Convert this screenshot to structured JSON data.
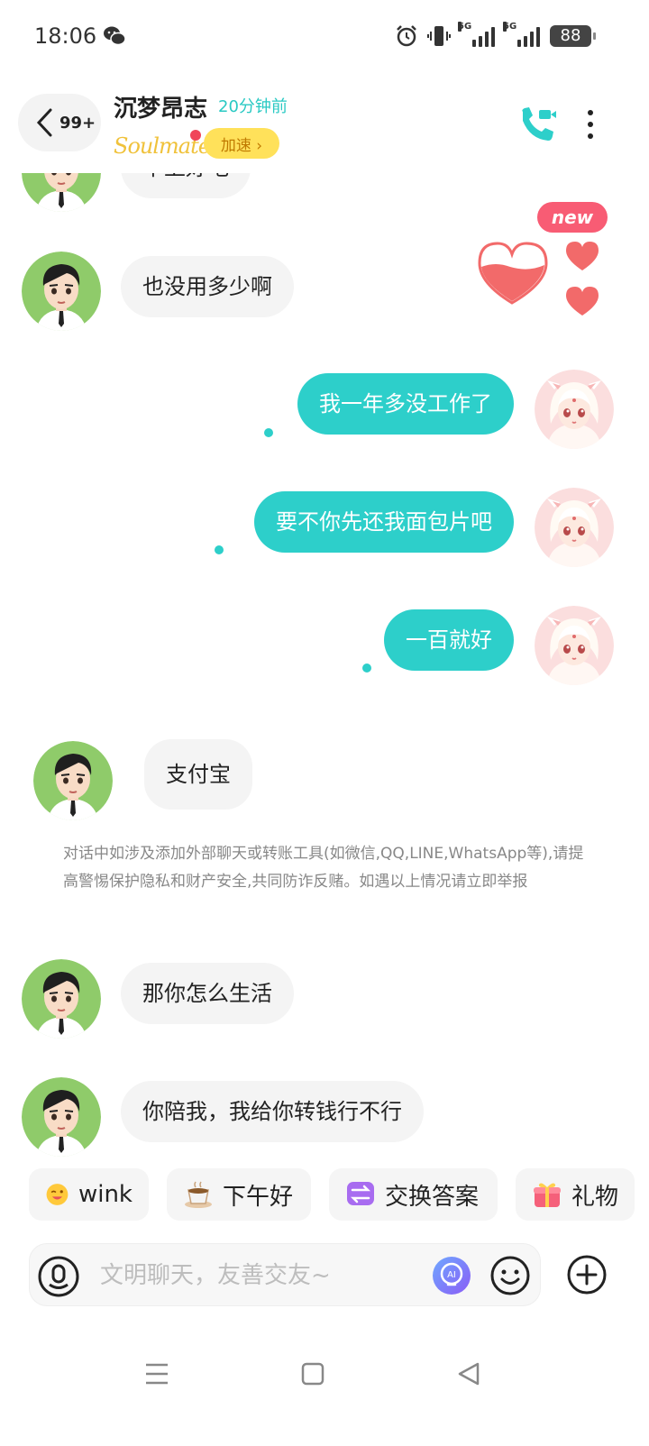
{
  "status_bar": {
    "time": "18:06",
    "battery": "88",
    "network_label_1": "5G",
    "network_label_2": "5G",
    "icons": [
      "wechat-icon",
      "alarm-icon",
      "vibrate-icon",
      "signal-icon",
      "signal-icon",
      "battery-icon"
    ]
  },
  "header": {
    "back_count": "99+",
    "contact_name": "沉梦昂志",
    "last_seen": "20分钟前",
    "brand": "Soulmate",
    "speed_label": "加速 ›"
  },
  "messages": [
    {
      "side": "in",
      "text": "早上好吧"
    },
    {
      "side": "in",
      "text": "也没用多少啊"
    },
    {
      "side": "out",
      "text": "我一年多没工作了"
    },
    {
      "side": "out",
      "text": "要不你先还我面包片吧"
    },
    {
      "side": "out",
      "text": "一百就好"
    },
    {
      "side": "in",
      "text": "支付宝"
    },
    {
      "side": "in",
      "text": "那你怎么生活"
    },
    {
      "side": "in",
      "text": "你陪我，我给你转钱行不行"
    }
  ],
  "warning_text": "对话中如涉及添加外部聊天或转账工具(如微信,QQ,LINE,WhatsApp等),请提高警惕保护隐私和财产安全,共同防诈反赌。如遇以上情况请立即举报",
  "badge_new": "new",
  "quick_replies": [
    {
      "label": "wink",
      "icon": "wink-emoji-icon"
    },
    {
      "label": "下午好",
      "icon": "coffee-icon"
    },
    {
      "label": "交换答案",
      "icon": "exchange-icon"
    },
    {
      "label": "礼物",
      "icon": "gift-icon"
    }
  ],
  "input": {
    "placeholder": "文明聊天，友善交友~",
    "value": ""
  },
  "colors": {
    "accent": "#2dcfca",
    "bubble_in": "#f4f4f4",
    "badge": "#f85c74",
    "speed": "#ffe15a"
  }
}
